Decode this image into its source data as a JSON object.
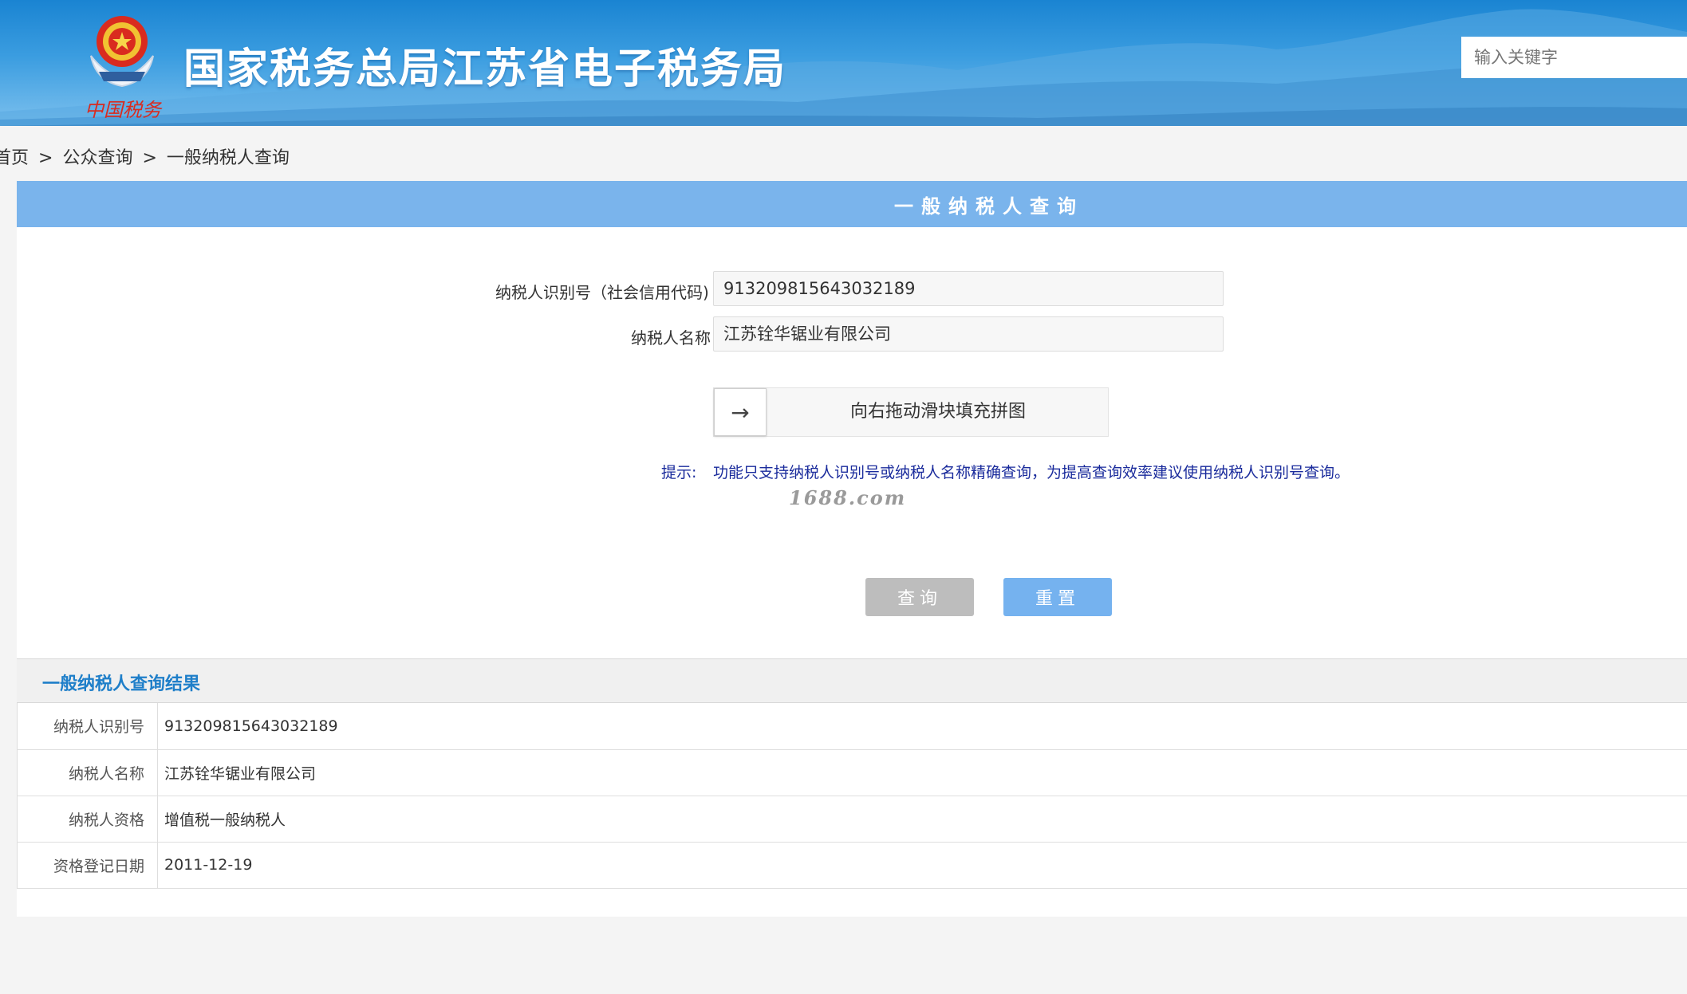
{
  "header": {
    "site_title": "国家税务总局江苏省电子税务局",
    "emblem_caption": "中国税务",
    "search_placeholder": "输入关键字",
    "colors": {
      "banner_top": "#1a84d2",
      "banner_bottom": "#7cc0ee"
    }
  },
  "breadcrumb": {
    "items": [
      "首页",
      "公众查询",
      "一般纳税人查询"
    ],
    "separator": ">"
  },
  "panel": {
    "title": "一般纳税人查询",
    "accent_color": "#7ab4ec"
  },
  "form": {
    "taxpayer_id_label": "纳税人识别号（社会信用代码)",
    "taxpayer_id_value": "913209815643032189",
    "taxpayer_name_label": "纳税人名称",
    "taxpayer_name_value": "江苏铨华锯业有限公司",
    "slider_text": "向右拖动滑块填充拼图",
    "slider_icon": "arrow-right-icon",
    "hint_label": "提示:",
    "hint_text": "功能只支持纳税人识别号或纳税人名称精确查询，为提高查询效率建议使用纳税人识别号查询。",
    "watermark": "1688.com",
    "query_button": "查询",
    "reset_button": "重置"
  },
  "result": {
    "title": "一般纳税人查询结果",
    "rows": [
      {
        "key": "纳税人识别号",
        "value": "913209815643032189"
      },
      {
        "key": "纳税人名称",
        "value": "江苏铨华锯业有限公司"
      },
      {
        "key": "纳税人资格",
        "value": "增值税一般纳税人"
      },
      {
        "key": "资格登记日期",
        "value": "2011-12-19"
      }
    ]
  }
}
